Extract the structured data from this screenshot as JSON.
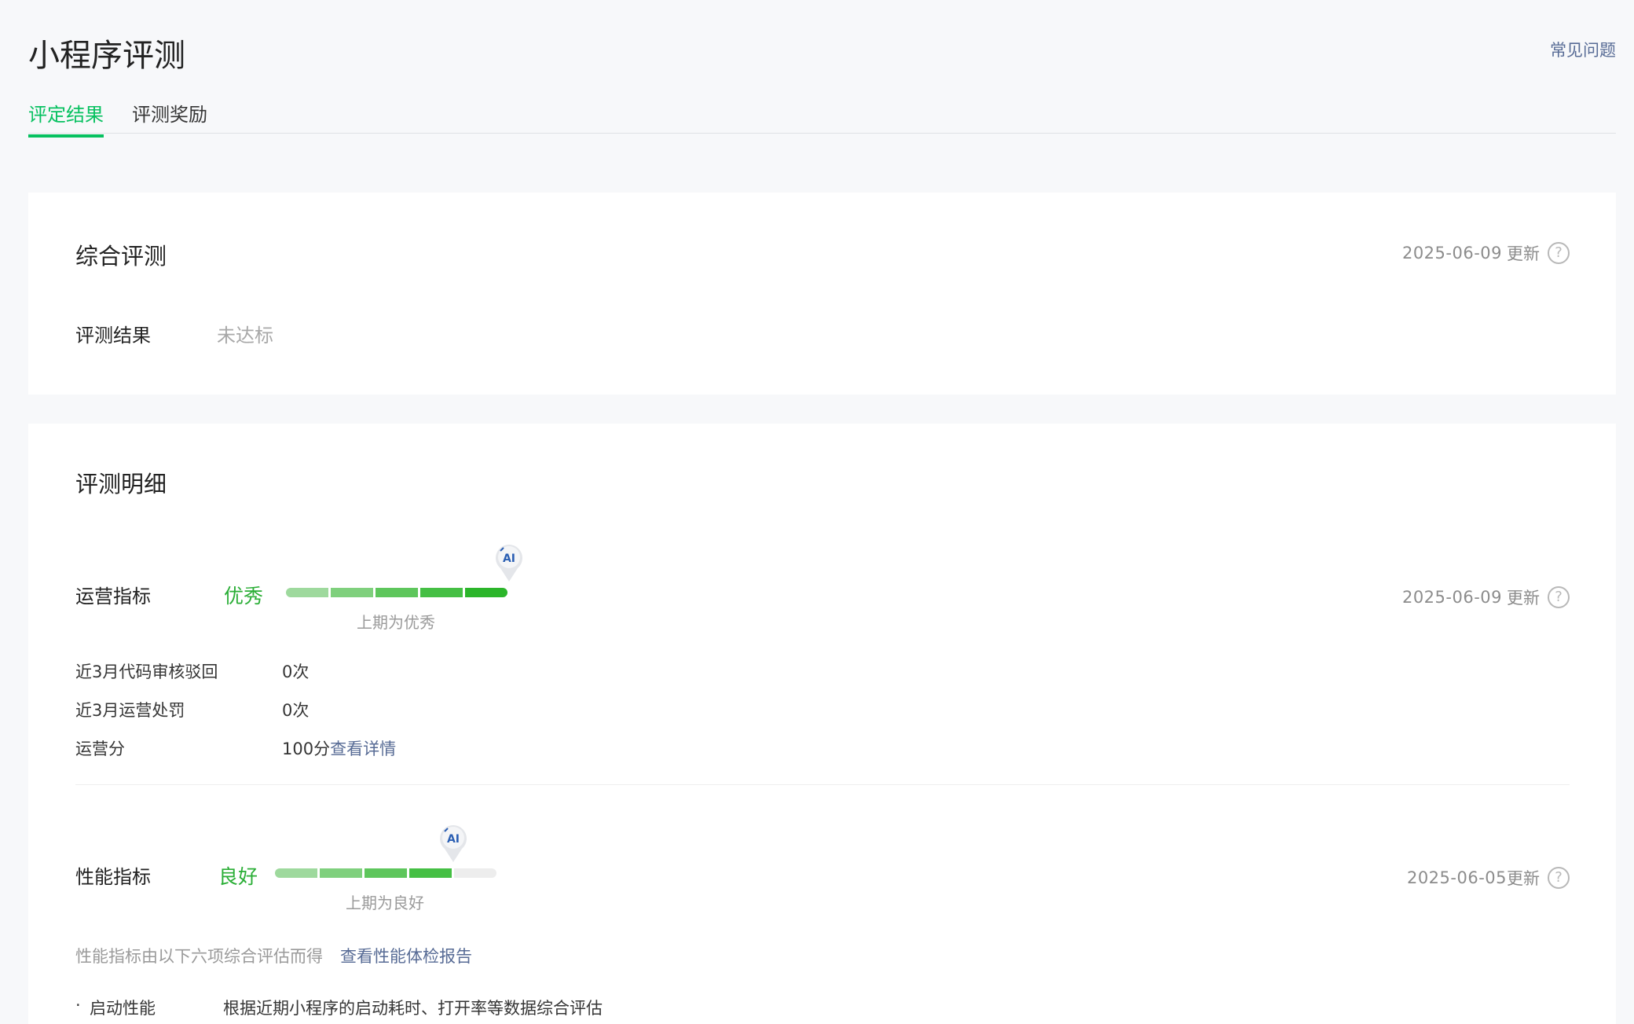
{
  "header": {
    "title": "小程序评测",
    "faq": "常见问题"
  },
  "tabs": [
    {
      "label": "评定结果",
      "active": true
    },
    {
      "label": "评测奖励",
      "active": false
    }
  ],
  "overall": {
    "title": "综合评测",
    "update_date": "2025-06-09",
    "update_suffix": "更新",
    "result_label": "评测结果",
    "result_value": "未达标"
  },
  "detail": {
    "title": "评测明细",
    "operation": {
      "label": "运营指标",
      "grade": "优秀",
      "level": 5,
      "levels_total": 5,
      "prev_text": "上期为优秀",
      "update_date": "2025-06-09",
      "update_suffix": "更新",
      "rows": [
        {
          "label": "近3月代码审核驳回",
          "value": "0次"
        },
        {
          "label": "近3月运营处罚",
          "value": "0次"
        },
        {
          "label": "运营分",
          "value": "100分",
          "link": "查看详情"
        }
      ]
    },
    "performance": {
      "label": "性能指标",
      "grade": "良好",
      "level": 4,
      "levels_total": 5,
      "prev_text": "上期为良好",
      "update_date": "2025-06-05",
      "update_suffix": "更新",
      "description": "性能指标由以下六项综合评估而得",
      "report_link": "查看性能体检报告",
      "items": [
        {
          "name": "启动性能",
          "desc": "根据近期小程序的启动耗时、打开率等数据综合评估"
        }
      ]
    }
  },
  "colors": {
    "accent": "#07c160",
    "grade_green": "#2aae36",
    "link": "#576b95"
  },
  "icons": {
    "marker": "ai-marker-icon",
    "help": "help-circle-icon"
  }
}
